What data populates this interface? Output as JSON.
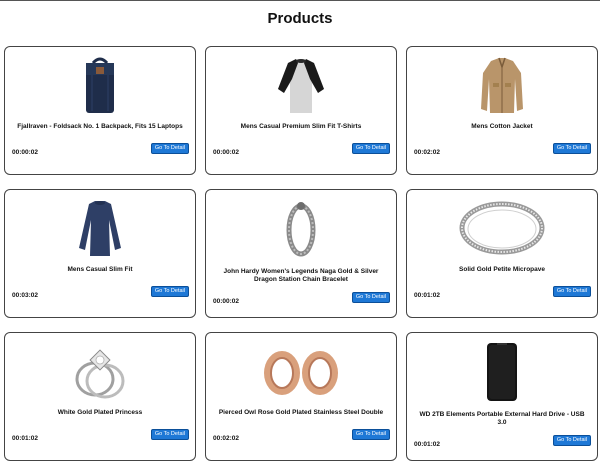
{
  "page": {
    "title": "Products"
  },
  "actions": {
    "detail_label": "Go To Detail"
  },
  "products": [
    {
      "title": "Fjallraven - Foldsack No. 1 Backpack, Fits 15 Laptops",
      "timer": "00:00:02",
      "icon": "backpack-icon"
    },
    {
      "title": "Mens Casual Premium Slim Fit T-Shirts",
      "timer": "00:00:02",
      "icon": "tshirt-icon"
    },
    {
      "title": "Mens Cotton Jacket",
      "timer": "00:02:02",
      "icon": "jacket-icon"
    },
    {
      "title": "Mens Casual Slim Fit",
      "timer": "00:03:02",
      "icon": "longsleeve-icon"
    },
    {
      "title": "John Hardy Women's Legends Naga Gold & Silver Dragon Station Chain Bracelet",
      "timer": "00:00:02",
      "icon": "bracelet-icon"
    },
    {
      "title": "Solid Gold Petite Micropave",
      "timer": "00:01:02",
      "icon": "ring-icon"
    },
    {
      "title": "White Gold Plated Princess",
      "timer": "00:01:02",
      "icon": "diamond-ring-icon"
    },
    {
      "title": "Pierced Owl Rose Gold Plated Stainless Steel Double",
      "timer": "00:02:02",
      "icon": "ear-tunnel-icon"
    },
    {
      "title": "WD 2TB Elements Portable External Hard Drive - USB 3.0",
      "timer": "00:01:02",
      "icon": "hard-drive-icon"
    }
  ]
}
